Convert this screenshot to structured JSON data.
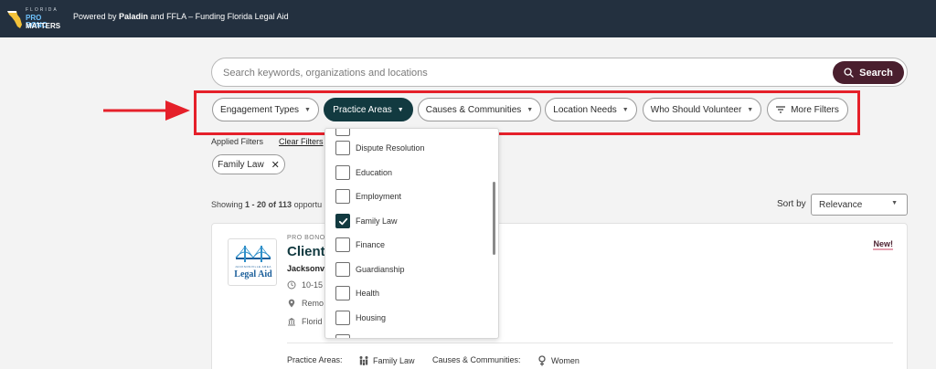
{
  "header": {
    "logo": {
      "line1": "FLORIDA",
      "line2": "PRO BONO",
      "line3": "MATTERS"
    },
    "powered_prefix": "Powered by ",
    "powered_bold": "Paladin",
    "powered_suffix": " and FFLA – Funding Florida Legal Aid"
  },
  "search": {
    "placeholder": "Search keywords, organizations and locations",
    "button_label": "Search"
  },
  "filters": [
    {
      "label": "Engagement Types",
      "active": false
    },
    {
      "label": "Practice Areas",
      "active": true
    },
    {
      "label": "Causes & Communities",
      "active": false
    },
    {
      "label": "Location Needs",
      "active": false
    },
    {
      "label": "Who Should Volunteer",
      "active": false
    },
    {
      "label": "More Filters",
      "active": false
    }
  ],
  "applied": {
    "label": "Applied Filters",
    "clear_label": "Clear Filters",
    "tags": [
      "Family Law"
    ]
  },
  "results": {
    "showing_prefix": "Showing ",
    "showing_range": "1 - 20 of 113",
    "showing_suffix": " opportu",
    "sort_label": "Sort by",
    "sort_value": "Relevance"
  },
  "dropdown": {
    "options": [
      {
        "label": "Dispute Resolution",
        "checked": false
      },
      {
        "label": "Education",
        "checked": false
      },
      {
        "label": "Employment",
        "checked": false
      },
      {
        "label": "Family Law",
        "checked": true
      },
      {
        "label": "Finance",
        "checked": false
      },
      {
        "label": "Guardianship",
        "checked": false
      },
      {
        "label": "Health",
        "checked": false
      },
      {
        "label": "Housing",
        "checked": false
      }
    ]
  },
  "card": {
    "logo_top": "JACKSONVILLE AREA",
    "logo_main": "Legal Aid",
    "org_type": "PRO BONO",
    "title": "Client",
    "org": "Jacksonv",
    "meta_time": "10-15",
    "meta_location": "Remo",
    "meta_venue": "Florid",
    "badge": "New!",
    "practice_label": "Practice Areas:",
    "practice_value": "Family Law",
    "causes_label": "Causes & Communities:",
    "causes_value": "Women"
  },
  "colors": {
    "topbar": "#23303f",
    "accent": "#4a1f2e",
    "active_chip": "#123a40",
    "highlight": "#e5202a"
  }
}
